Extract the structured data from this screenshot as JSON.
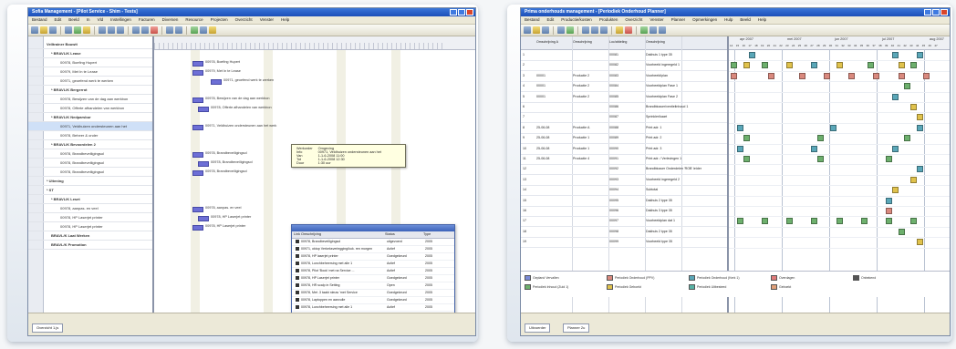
{
  "window1": {
    "title": "Sofia Management - [Pilot Service - Shim - Tests]",
    "menu": [
      "Bestand",
      "Edit",
      "Beeld",
      "In",
      "Vld",
      "Instellingen",
      "Facturen",
      "Diversen",
      "Resource",
      "Projecten",
      "Overzicht",
      "Venster",
      "Help"
    ],
    "tree": [
      {
        "num": "",
        "label": "Velltrainer Bouwit",
        "bold": true,
        "indent": 0
      },
      {
        "num": "",
        "label": "* BRAVL/K Lease",
        "bold": true,
        "indent": 1
      },
      {
        "num": "",
        "label": "00978, Boefing Hupert",
        "bold": false,
        "indent": 3
      },
      {
        "num": "",
        "label": "00979, Met In te Lease",
        "bold": false,
        "indent": 3
      },
      {
        "num": "",
        "label": "00971, geoefend werk te werken",
        "bold": false,
        "indent": 3
      },
      {
        "num": "",
        "label": "* BRAVL/K Bergerrot",
        "bold": true,
        "indent": 1
      },
      {
        "num": "",
        "label": "00978, Bewijzen van de dag aan werkbon",
        "bold": false,
        "indent": 3
      },
      {
        "num": "",
        "label": "00978, Offerte afhandelen van werkbon",
        "bold": false,
        "indent": 3
      },
      {
        "num": "",
        "label": "* BRAVL/K Nedparsbur",
        "bold": true,
        "indent": 1
      },
      {
        "num": "",
        "label": "00971, Veldhuizen ondersteunen aan het",
        "bold": false,
        "indent": 3,
        "selected": true
      },
      {
        "num": "",
        "label": "00978, Beheer & onder",
        "bold": false,
        "indent": 3
      },
      {
        "num": "",
        "label": "* BRAVL/K Bevoordelen 2",
        "bold": true,
        "indent": 1
      },
      {
        "num": "",
        "label": "00978, Brandbeveiligingsol",
        "bold": false,
        "indent": 3
      },
      {
        "num": "",
        "label": "00978, Brandbeveiligingsol",
        "bold": false,
        "indent": 3
      },
      {
        "num": "",
        "label": "00978, Brandbeveiligingsol",
        "bold": false,
        "indent": 3
      },
      {
        "num": "",
        "label": "* Uitening",
        "bold": true,
        "indent": 0
      },
      {
        "num": "",
        "label": "* ST",
        "bold": true,
        "indent": 0
      },
      {
        "num": "",
        "label": "* BRAVL/K Leset",
        "bold": true,
        "indent": 1
      },
      {
        "num": "",
        "label": "00978, aanpas. en veel",
        "bold": false,
        "indent": 3
      },
      {
        "num": "",
        "label": "00978, HP Laserjet printer",
        "bold": false,
        "indent": 3
      },
      {
        "num": "",
        "label": "00978, HP Laserjet printer",
        "bold": false,
        "indent": 3
      },
      {
        "num": "",
        "label": "BRAVL/K Laat Werken",
        "bold": true,
        "indent": 1
      },
      {
        "num": "",
        "label": "BRAVL/K Promotion",
        "bold": true,
        "indent": 1
      }
    ],
    "gantt_labels": [
      {
        "row": 2,
        "text": "00978, Boefing Hupert"
      },
      {
        "row": 3,
        "text": "00979, Met In te Lease"
      },
      {
        "row": 4,
        "text": "00971, geoefend werk te werken"
      },
      {
        "row": 6,
        "text": "00978, Bewijzen van de dag aan werkbon"
      },
      {
        "row": 7,
        "text": "00978, Offerte afhandelen van werkbon"
      },
      {
        "row": 9,
        "text": "00971, Veldhuizen ondersteunen aan het werk"
      },
      {
        "row": 12,
        "text": "00978, Brandbeveiligingsol"
      },
      {
        "row": 13,
        "text": "00978, Brandbeveiligingsol"
      },
      {
        "row": 14,
        "text": "00978, Brandbeveiligingsol"
      },
      {
        "row": 18,
        "text": "00978, aanpas. en veel"
      },
      {
        "row": 19,
        "text": "00978, HP Laserjet printer"
      },
      {
        "row": 20,
        "text": "00978, HP Laserjet printer"
      }
    ],
    "tooltip": {
      "rows": [
        [
          "Werkorder",
          "Omgeving"
        ],
        [
          "Info",
          "00971, Veldhuizen ondersteunen aan het"
        ],
        [
          "Van",
          "1-1-6-2008 11:00"
        ],
        [
          "Tot",
          "1-1-6-2008 12:30"
        ],
        [
          "Duur",
          "1:30 uur"
        ]
      ]
    },
    "popup": {
      "headers": [
        "Link Omschrijving",
        "Status",
        "Type"
      ],
      "rows": [
        [
          "00978, Brandbeveiligingsol",
          "uitgevoerd",
          "2005"
        ],
        [
          "00971, oktop Verkeksverlegging/kuk. ren morgen",
          "Actief",
          "2005"
        ],
        [
          "00978, HP laserjet printer",
          "Goedgekeurd",
          "2005"
        ],
        [
          "00978, Lunchbeheersing met alle 1",
          "Actief",
          "2005"
        ],
        [
          "00978, Pilot 'Book' met na Service ...",
          "Actief",
          "2005"
        ],
        [
          "00978, HP Laserjet printer",
          "Goedgekeurd",
          "2005"
        ],
        [
          "00978, HR scalp in Setting",
          "Open",
          "2005"
        ],
        [
          "00978, Met .3 taakt nieuw 'met Service",
          "Goedgekeurd",
          "2005"
        ],
        [
          "00978, Laptoppen en aanvulle",
          "Goedgekeurd",
          "2005"
        ],
        [
          "00978, Lunchbeheersing met alle 1",
          "Actief",
          "2005"
        ]
      ]
    },
    "tab_label": "Overzicht 1.js"
  },
  "window2": {
    "title": "Prima onderhouds management - [Periodiek Onderhoud Planner]",
    "menu": [
      "Bestand",
      "Edit",
      "Productie/kosten",
      "Produkten",
      "Overzicht",
      "Venster",
      "Planner",
      "Opmerkingen",
      "Hulp",
      "Beeld",
      "Help"
    ],
    "columns": [
      "Omschrijving A",
      "Omschrijving",
      "Loc/afdeling",
      "Omschrijving"
    ],
    "months": [
      "apr 2007",
      "mei 2007",
      "jun 2007",
      "jul 2007",
      "aug 2007"
    ],
    "rows": [
      {
        "c0": "",
        "c1": "",
        "c2": "00081",
        "c3": "Dakhuis 1 type 35"
      },
      {
        "c0": "",
        "c1": "",
        "c2": "00082",
        "c3": "Voorbeeld ingeregeld 1"
      },
      {
        "c0": "00001",
        "c1": "Productie 2",
        "c2": "00083",
        "c3": "Voorbeeld/plan"
      },
      {
        "c0": "00001",
        "c1": "Productie 2",
        "c2": "00084",
        "c3": "Voorbeeldplan Fase 1"
      },
      {
        "c0": "00001",
        "c1": "Productie 2",
        "c2": "00085",
        "c3": "Voorbeeldplan Fase 2"
      },
      {
        "c0": "",
        "c1": "",
        "c2": "00086",
        "c3": "Brandblusser/ventielinhoud 1"
      },
      {
        "c0": "",
        "c1": "",
        "c2": "00087",
        "c3": "Sprinkler/kaart"
      },
      {
        "c0": "25-06-08",
        "c1": "Productie A",
        "c2": "00088",
        "c3": "Print adr. 1"
      },
      {
        "c0": "25-06-08",
        "c1": "Productie 1",
        "c2": "00089",
        "c3": "Print adr. 2"
      },
      {
        "c0": "25-06-08",
        "c1": "Productie 1",
        "c2": "00090",
        "c3": "Print adr. 3"
      },
      {
        "c0": "25-06-08",
        "c1": "Productie 4",
        "c2": "00091",
        "c3": "Print adr. / Verlevingen 1"
      },
      {
        "c0": "",
        "c1": "",
        "c2": "00092",
        "c3": "Brandblusser Onderdelen 'ROB' leider"
      },
      {
        "c0": "",
        "c1": "",
        "c2": "00093",
        "c3": "Voorbeeld ingeregeld 2"
      },
      {
        "c0": "",
        "c1": "",
        "c2": "00094",
        "c3": "Subtotal"
      },
      {
        "c0": "",
        "c1": "",
        "c2": "00095",
        "c3": "Dakhuis 2 type 35"
      },
      {
        "c0": "",
        "c1": "",
        "c2": "00096",
        "c3": "Dakhuis 3 type 35"
      },
      {
        "c0": "",
        "c1": "",
        "c2": "00097",
        "c3": "Voorbeeldplan dat 1"
      },
      {
        "c0": "",
        "c1": "",
        "c2": "00098",
        "c3": "Dakhuis 2 type 35"
      },
      {
        "c0": "",
        "c1": "",
        "c2": "00099",
        "c3": "Voorbeeld type 35"
      }
    ],
    "appointments": [
      {
        "row": 0,
        "col": 3,
        "color": "#5aa7b8"
      },
      {
        "row": 0,
        "col": 26,
        "color": "#5aa7b8"
      },
      {
        "row": 0,
        "col": 30,
        "color": "#5aa7b8"
      },
      {
        "row": 1,
        "col": 0,
        "color": "#6db06d"
      },
      {
        "row": 1,
        "col": 2,
        "color": "#e0c24c"
      },
      {
        "row": 1,
        "col": 5,
        "color": "#6db06d"
      },
      {
        "row": 1,
        "col": 9,
        "color": "#e0c24c"
      },
      {
        "row": 1,
        "col": 13,
        "color": "#5aa7b8"
      },
      {
        "row": 1,
        "col": 17,
        "color": "#e0c24c"
      },
      {
        "row": 1,
        "col": 22,
        "color": "#6db06d"
      },
      {
        "row": 1,
        "col": 27,
        "color": "#e0c24c"
      },
      {
        "row": 1,
        "col": 29,
        "color": "#6db06d"
      },
      {
        "row": 2,
        "col": 0,
        "color": "#d9897e"
      },
      {
        "row": 2,
        "col": 6,
        "color": "#d9897e"
      },
      {
        "row": 2,
        "col": 11,
        "color": "#d9897e"
      },
      {
        "row": 2,
        "col": 15,
        "color": "#d9897e"
      },
      {
        "row": 2,
        "col": 19,
        "color": "#d9897e"
      },
      {
        "row": 2,
        "col": 23,
        "color": "#d9897e"
      },
      {
        "row": 2,
        "col": 27,
        "color": "#d9897e"
      },
      {
        "row": 2,
        "col": 31,
        "color": "#d9897e"
      },
      {
        "row": 3,
        "col": 28,
        "color": "#6db06d"
      },
      {
        "row": 4,
        "col": 26,
        "color": "#5aa7b8"
      },
      {
        "row": 5,
        "col": 29,
        "color": "#e0c24c"
      },
      {
        "row": 6,
        "col": 30,
        "color": "#e0c24c"
      },
      {
        "row": 7,
        "col": 1,
        "color": "#5aa7b8"
      },
      {
        "row": 7,
        "col": 16,
        "color": "#5aa7b8"
      },
      {
        "row": 7,
        "col": 30,
        "color": "#5aa7b8"
      },
      {
        "row": 8,
        "col": 2,
        "color": "#6db06d"
      },
      {
        "row": 8,
        "col": 14,
        "color": "#6db06d"
      },
      {
        "row": 8,
        "col": 28,
        "color": "#6db06d"
      },
      {
        "row": 9,
        "col": 1,
        "color": "#5aa7b8"
      },
      {
        "row": 9,
        "col": 13,
        "color": "#5aa7b8"
      },
      {
        "row": 9,
        "col": 26,
        "color": "#5aa7b8"
      },
      {
        "row": 10,
        "col": 2,
        "color": "#6db06d"
      },
      {
        "row": 10,
        "col": 14,
        "color": "#6db06d"
      },
      {
        "row": 10,
        "col": 25,
        "color": "#6db06d"
      },
      {
        "row": 11,
        "col": 30,
        "color": "#5aa7b8"
      },
      {
        "row": 12,
        "col": 29,
        "color": "#e0c24c"
      },
      {
        "row": 13,
        "col": 26,
        "color": "#e0c24c"
      },
      {
        "row": 14,
        "col": 25,
        "color": "#5aa7b8"
      },
      {
        "row": 15,
        "col": 25,
        "color": "#d9897e"
      },
      {
        "row": 16,
        "col": 1,
        "color": "#6db06d"
      },
      {
        "row": 16,
        "col": 5,
        "color": "#6db06d"
      },
      {
        "row": 16,
        "col": 9,
        "color": "#6db06d"
      },
      {
        "row": 16,
        "col": 13,
        "color": "#6db06d"
      },
      {
        "row": 16,
        "col": 17,
        "color": "#6db06d"
      },
      {
        "row": 16,
        "col": 21,
        "color": "#6db06d"
      },
      {
        "row": 16,
        "col": 25,
        "color": "#6db06d"
      },
      {
        "row": 16,
        "col": 29,
        "color": "#6db06d"
      },
      {
        "row": 17,
        "col": 27,
        "color": "#6db06d"
      },
      {
        "row": 18,
        "col": 30,
        "color": "#e0c24c"
      }
    ],
    "legend": [
      {
        "label": "Gepland Vervallen",
        "color": "#7a8ad6"
      },
      {
        "label": "Periodiek Onderhoud (PPV)",
        "color": "#d9897e"
      },
      {
        "label": "Periodiek Onderhoud (Kerk 1)",
        "color": "#5aa7b8"
      },
      {
        "label": "Overdagen",
        "color": "#e07a7a"
      },
      {
        "label": "Onbekend",
        "color": "#555555"
      },
      {
        "label": "Periodiek Inhoud (Zuid 1)",
        "color": "#6db06d"
      },
      {
        "label": "Periodiek Geboekt",
        "color": "#e0c24c"
      },
      {
        "label": "Periodiek Uitbesteed",
        "color": "#58b3a5"
      },
      {
        "label": "Geboekt",
        "color": "#e0a07a"
      }
    ],
    "tabs": [
      "Uitvoerder",
      "Planner 2u"
    ]
  }
}
